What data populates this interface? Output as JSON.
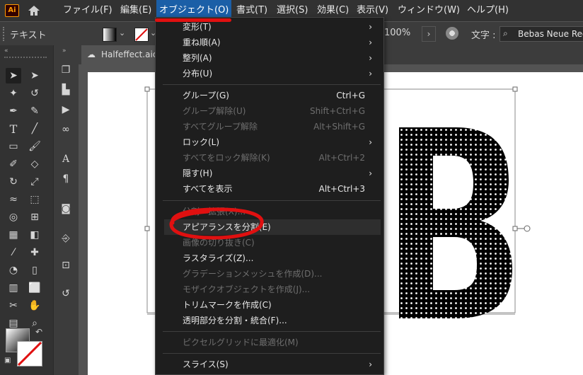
{
  "app": {
    "logo": "Ai"
  },
  "menubar": {
    "file": "ファイル(F)",
    "edit": "編集(E)",
    "object": "オブジェクト(O)",
    "type": "書式(T)",
    "select": "選択(S)",
    "effect": "効果(C)",
    "view": "表示(V)",
    "window": "ウィンドウ(W)",
    "help": "ヘルプ(H)"
  },
  "control": {
    "mode_label": "テキスト",
    "zoom": "100%",
    "char_label": "文字 :",
    "font": "Bebas Neue Reg"
  },
  "tab": {
    "title": "Halfeffect.aic"
  },
  "canvas": {
    "letter": "B"
  },
  "menu": {
    "items": [
      {
        "label": "変形(T)",
        "shortcut": "",
        "submenu": true,
        "enabled": true
      },
      {
        "label": "重ね順(A)",
        "shortcut": "",
        "submenu": true,
        "enabled": true
      },
      {
        "label": "整列(A)",
        "shortcut": "",
        "submenu": true,
        "enabled": true
      },
      {
        "label": "分布(U)",
        "shortcut": "",
        "submenu": true,
        "enabled": true
      },
      {
        "label": "グループ(G)",
        "shortcut": "Ctrl+G",
        "submenu": false,
        "enabled": true
      },
      {
        "label": "グループ解除(U)",
        "shortcut": "Shift+Ctrl+G",
        "submenu": false,
        "enabled": false
      },
      {
        "label": "すべてグループ解除",
        "shortcut": "Alt+Shift+G",
        "submenu": false,
        "enabled": false
      },
      {
        "label": "ロック(L)",
        "shortcut": "",
        "submenu": true,
        "enabled": true
      },
      {
        "label": "すべてをロック解除(K)",
        "shortcut": "Alt+Ctrl+2",
        "submenu": false,
        "enabled": false
      },
      {
        "label": "隠す(H)",
        "shortcut": "",
        "submenu": true,
        "enabled": true
      },
      {
        "label": "すべてを表示",
        "shortcut": "Alt+Ctrl+3",
        "submenu": false,
        "enabled": true
      },
      {
        "label": "分割・拡張(X)...",
        "shortcut": "",
        "submenu": false,
        "enabled": false
      },
      {
        "label": "アピアランスを分割(E)",
        "shortcut": "",
        "submenu": false,
        "enabled": true
      },
      {
        "label": "画像の切り抜き(C)",
        "shortcut": "",
        "submenu": false,
        "enabled": false
      },
      {
        "label": "ラスタライズ(Z)...",
        "shortcut": "",
        "submenu": false,
        "enabled": true
      },
      {
        "label": "グラデーションメッシュを作成(D)...",
        "shortcut": "",
        "submenu": false,
        "enabled": false
      },
      {
        "label": "モザイクオブジェクトを作成(J)...",
        "shortcut": "",
        "submenu": false,
        "enabled": false
      },
      {
        "label": "トリムマークを作成(C)",
        "shortcut": "",
        "submenu": false,
        "enabled": true
      },
      {
        "label": "透明部分を分割・統合(F)...",
        "shortcut": "",
        "submenu": false,
        "enabled": true
      },
      {
        "label": "ピクセルグリッドに最適化(M)",
        "shortcut": "",
        "submenu": false,
        "enabled": false
      },
      {
        "label": "スライス(S)",
        "shortcut": "",
        "submenu": true,
        "enabled": true
      }
    ]
  },
  "colors": {
    "accent": "#1b5fa7",
    "annotation": "#e01010",
    "menu_bg": "#1e1e1e"
  }
}
